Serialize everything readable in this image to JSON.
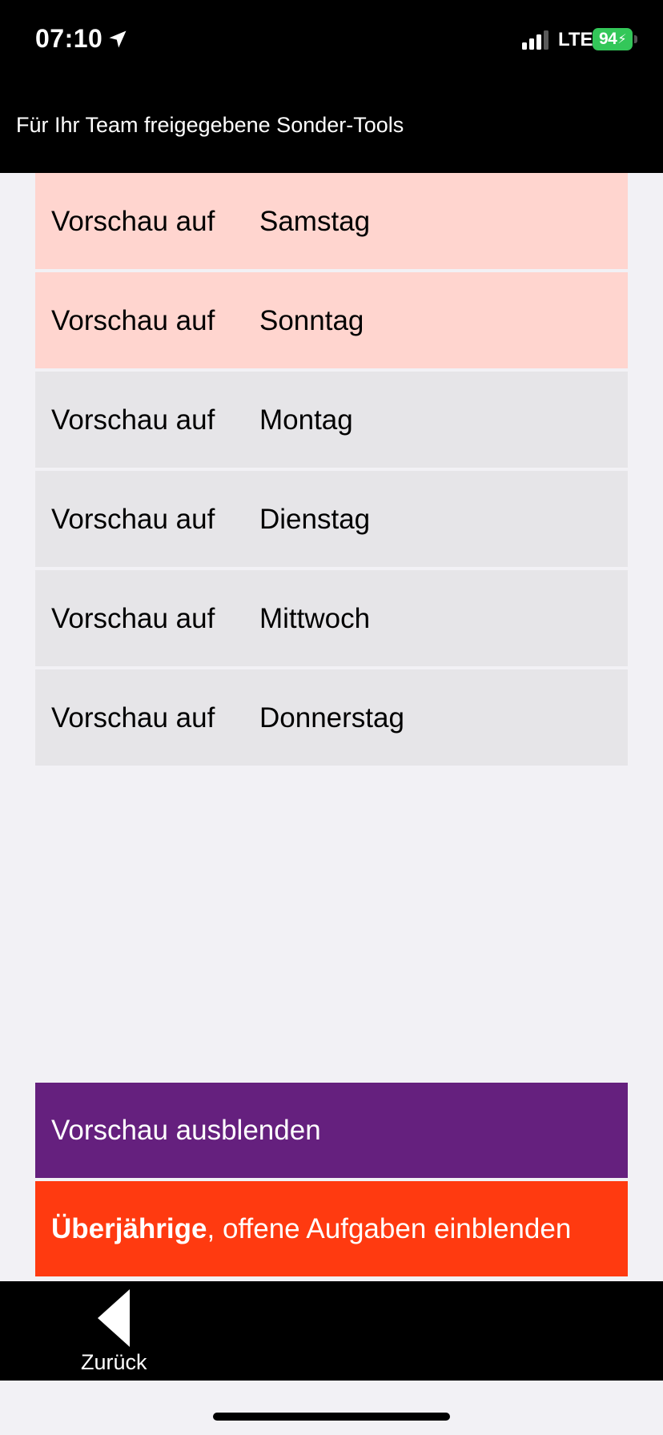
{
  "status_bar": {
    "time": "07:10",
    "network": "LTE",
    "battery": "94"
  },
  "header": {
    "title": "Für Ihr Team freigegebene Sonder-Tools"
  },
  "preview_rows": [
    {
      "prefix": "Vorschau auf",
      "day": "Samstag",
      "highlight": true
    },
    {
      "prefix": "Vorschau auf",
      "day": "Sonntag",
      "highlight": true
    },
    {
      "prefix": "Vorschau auf",
      "day": "Montag",
      "highlight": false
    },
    {
      "prefix": "Vorschau auf",
      "day": "Dienstag",
      "highlight": false
    },
    {
      "prefix": "Vorschau auf",
      "day": "Mittwoch",
      "highlight": false
    },
    {
      "prefix": "Vorschau auf",
      "day": "Donnerstag",
      "highlight": false
    }
  ],
  "actions": {
    "hide_preview_label": "Vorschau ausblenden",
    "overdue_bold": "Überjährige",
    "overdue_rest": ", offene Aufgaben einblenden"
  },
  "bottom_bar": {
    "back_label": "Zurück"
  },
  "colors": {
    "weekend_row": "#ffd5cf",
    "weekday_row": "#e6e5e8",
    "hide_button": "#65207e",
    "overdue_button": "#ff3a10",
    "battery": "#33c759"
  }
}
